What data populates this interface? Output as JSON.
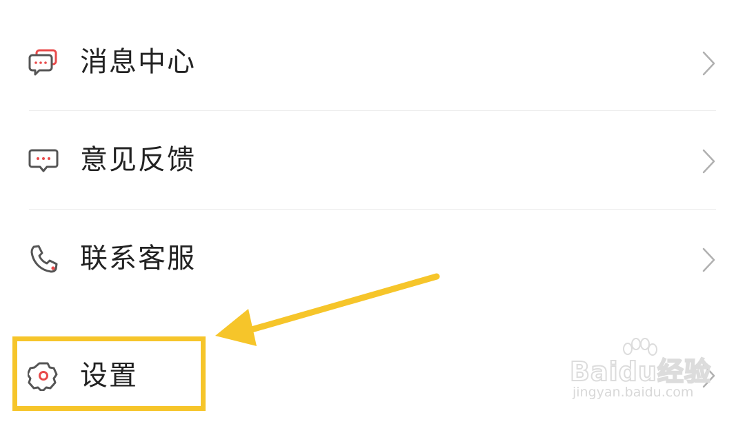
{
  "menu": {
    "items": [
      {
        "label": "消息中心",
        "icon": "message-center-icon"
      },
      {
        "label": "意见反馈",
        "icon": "feedback-icon"
      },
      {
        "label": "联系客服",
        "icon": "phone-icon"
      },
      {
        "label": "设置",
        "icon": "settings-gear-icon"
      }
    ],
    "chevron_icon": "chevron-right-icon"
  },
  "annotation": {
    "highlight_color": "#f6c52a",
    "arrow_color": "#f6c52a",
    "highlighted_item": "设置"
  },
  "colors": {
    "accent_red": "#e84a4a",
    "icon_gray": "#555555",
    "text": "#222222",
    "chevron": "#b0b0b0",
    "divider": "#ececec"
  },
  "watermark": {
    "logo_text": "Baidu经验",
    "url": "jingyan.baidu.com"
  }
}
